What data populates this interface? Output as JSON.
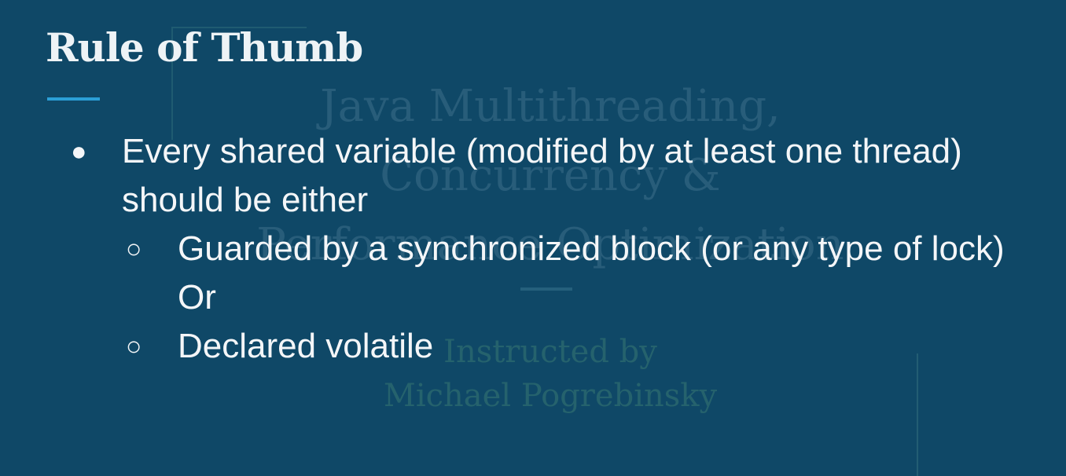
{
  "watermark": {
    "title": "Java Multithreading,\nConcurrency &\nPerformance Optimization",
    "instructor": "Instructed by\nMichael Pogrebinsky"
  },
  "slide": {
    "title": "Rule of Thumb",
    "bullets": [
      {
        "symbol": "●",
        "text": "Every shared variable (modified by at least one thread) should be either"
      }
    ],
    "sub_bullets": [
      {
        "symbol": "○",
        "text": "Guarded by a synchronized block (or any type of lock)"
      },
      {
        "symbol": "",
        "text": "Or"
      },
      {
        "symbol": "○",
        "text": "Declared volatile"
      }
    ],
    "accent_color": "#2b9fd6",
    "background_color": "#0f4867"
  }
}
